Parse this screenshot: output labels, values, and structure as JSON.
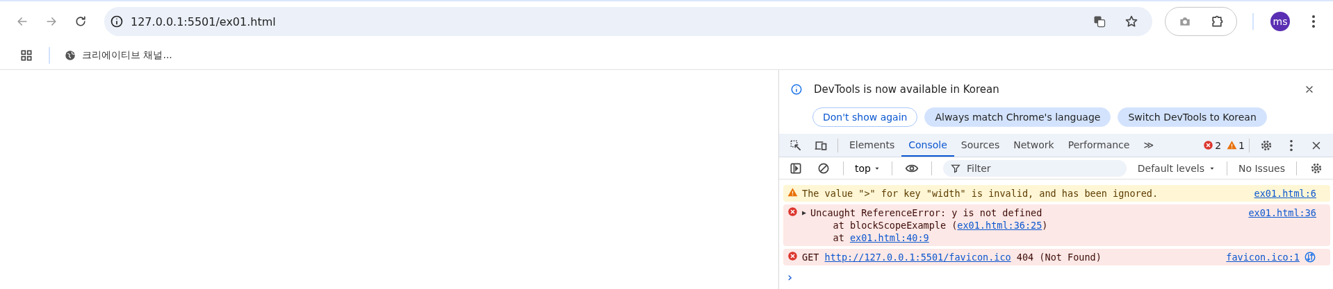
{
  "browser": {
    "url": "127.0.0.1:5501/ex01.html",
    "bookmarks": [
      {
        "label": "크리에이티브 채널..."
      }
    ],
    "avatar": "ms"
  },
  "devtools": {
    "infobar": {
      "message": "DevTools is now available in Korean",
      "buttons": [
        {
          "label": "Don't show again",
          "kind": "outline"
        },
        {
          "label": "Always match Chrome's language",
          "kind": "filled"
        },
        {
          "label": "Switch DevTools to Korean",
          "kind": "filled"
        }
      ]
    },
    "tabs": [
      {
        "label": "Elements",
        "selected": false
      },
      {
        "label": "Console",
        "selected": true
      },
      {
        "label": "Sources",
        "selected": false
      },
      {
        "label": "Network",
        "selected": false
      },
      {
        "label": "Performance",
        "selected": false
      }
    ],
    "more_tabs": "≫",
    "error_count": "2",
    "warning_count": "1",
    "console_toolbar": {
      "context": "top",
      "filter_placeholder": "Filter",
      "levels": "Default levels",
      "issues": "No Issues"
    },
    "messages": [
      {
        "kind": "warning",
        "lines": [
          [
            {
              "text": "The value \">\" for key \"width\" is invalid, and has been ignored.",
              "link": false
            }
          ]
        ],
        "source": "ex01.html:6"
      },
      {
        "kind": "error",
        "toggle": "▶",
        "lines": [
          [
            {
              "text": "Uncaught ReferenceError: y is not defined",
              "link": false
            }
          ],
          [
            {
              "text": "    at blockScopeExample (",
              "link": false
            },
            {
              "text": "ex01.html:36:25",
              "link": true
            },
            {
              "text": ")",
              "link": false
            }
          ],
          [
            {
              "text": "    at ",
              "link": false
            },
            {
              "text": "ex01.html:40:9",
              "link": true
            }
          ]
        ],
        "source": "ex01.html:36"
      },
      {
        "kind": "error",
        "network": true,
        "lines": [
          [
            {
              "text": "GET ",
              "link": false
            },
            {
              "text": "http://127.0.0.1:5501/favicon.ico",
              "link": true
            },
            {
              "text": " 404 (Not Found)",
              "link": false
            }
          ]
        ],
        "source": "favicon.ico:1"
      }
    ],
    "prompt": "›"
  }
}
